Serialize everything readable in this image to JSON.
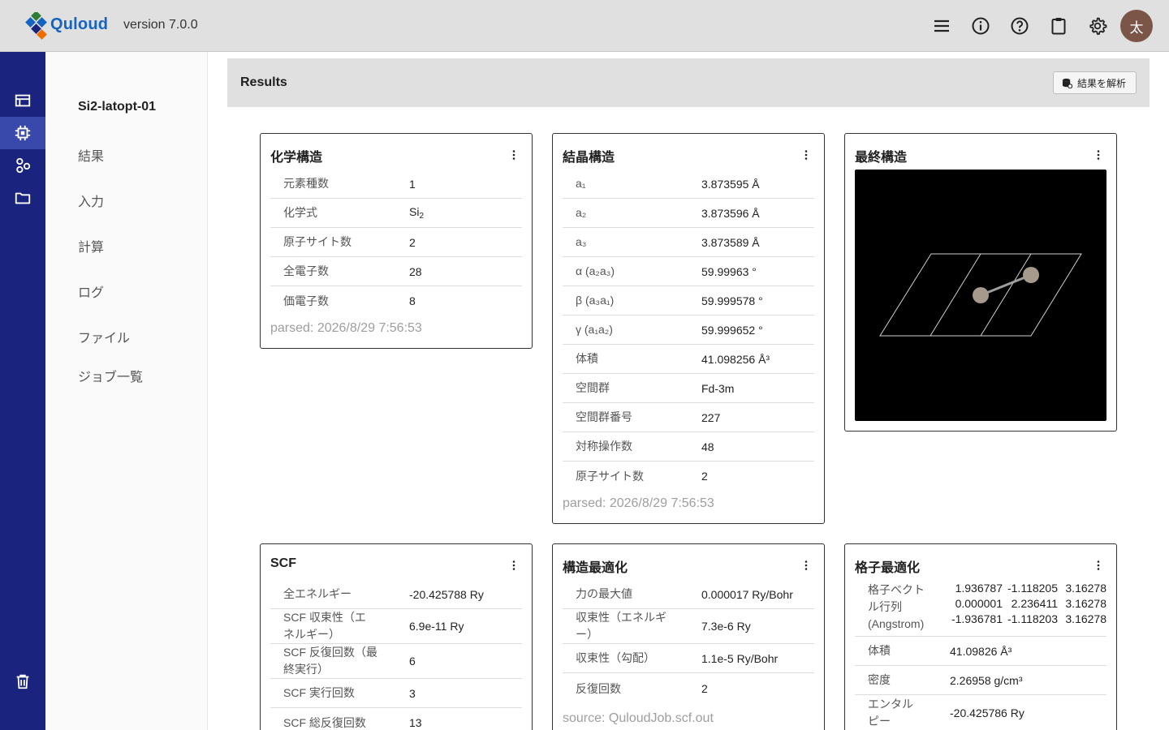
{
  "app": {
    "brand": "Quloud",
    "version": "version 7.0.0",
    "avatar_initial": "太",
    "colors": {
      "header": "#e0e0e0",
      "rail": "#1a237e",
      "rail_active": "#3949ab",
      "avatar": "#7a5548",
      "brand": "#1565c0"
    },
    "header_icons": [
      "menu-icon",
      "info-icon",
      "help-icon",
      "clipboard-icon",
      "gear-icon"
    ]
  },
  "rail": {
    "items": [
      "table-icon",
      "chip-icon",
      "apps-icon",
      "folder-icon"
    ],
    "bottom": "trash-icon",
    "active_index": 1
  },
  "subnav": {
    "job_name": "Si2-latopt-01",
    "items": [
      "結果",
      "入力",
      "計算",
      "ログ",
      "ファイル",
      "ジョブ一覧"
    ]
  },
  "results": {
    "title": "Results",
    "analyze_button": "結果を解析"
  },
  "chem_card": {
    "title": "化学構造",
    "rows": [
      {
        "k": "元素種数",
        "v": "1"
      },
      {
        "k": "化学式",
        "v": "Si",
        "sub": "2"
      },
      {
        "k": "原子サイト数",
        "v": "2"
      },
      {
        "k": "全電子数",
        "v": "28"
      },
      {
        "k": "価電子数",
        "v": "8"
      }
    ],
    "footer": "parsed: 2026/8/29 7:56:53"
  },
  "crystal_card": {
    "title": "結晶構造",
    "rows": [
      {
        "k": "a₁",
        "v": "3.873595 Å"
      },
      {
        "k": "a₂",
        "v": "3.873596 Å"
      },
      {
        "k": "a₃",
        "v": "3.873589 Å"
      },
      {
        "k": "α (a₂a₃)",
        "v": "59.99963 °"
      },
      {
        "k": "β (a₃a₁)",
        "v": "59.999578 °"
      },
      {
        "k": "γ (a₁a₂)",
        "v": "59.999652 °"
      },
      {
        "k": "体積",
        "v": "41.098256 Å³"
      },
      {
        "k": "空間群",
        "v": "Fd-3m"
      },
      {
        "k": "空間群番号",
        "v": "227"
      },
      {
        "k": "対称操作数",
        "v": "48"
      },
      {
        "k": "原子サイト数",
        "v": "2"
      }
    ],
    "footer": "parsed: 2026/8/29 7:56:53"
  },
  "final_card": {
    "title": "最終構造"
  },
  "scf_card": {
    "title": "SCF",
    "rows": [
      {
        "k": "全エネルギー",
        "v": "-20.425788 Ry"
      },
      {
        "k": "SCF 収束性（エネルギー）",
        "v": "6.9e-11 Ry"
      },
      {
        "k": "SCF 反復回数（最終実行）",
        "v": "6"
      },
      {
        "k": "SCF 実行回数",
        "v": "3"
      },
      {
        "k": "SCF 総反復回数",
        "v": "13"
      }
    ]
  },
  "opt_card": {
    "title": "構造最適化",
    "rows": [
      {
        "k": "力の最大値",
        "v": "0.000017 Ry/Bohr"
      },
      {
        "k": "収束性（エネルギー）",
        "v": "7.3e-6 Ry"
      },
      {
        "k": "収束性（勾配）",
        "v": "1.1e-5 Ry/Bohr"
      },
      {
        "k": "反復回数",
        "v": "2"
      }
    ],
    "footer": "source: QuloudJob.scf.out"
  },
  "lattice_card": {
    "title": "格子最適化",
    "matrix_label": "格子ベクトル行列 (Angstrom)",
    "matrix": [
      [
        "1.936787",
        "-1.118205",
        "3.16278"
      ],
      [
        "0.000001",
        "2.236411",
        "3.16278"
      ],
      [
        "-1.936781",
        "-1.118203",
        "3.16278"
      ]
    ],
    "rows": [
      {
        "k": "体積",
        "v": "41.09826 Å³"
      },
      {
        "k": "密度",
        "v": "2.26958 g/cm³"
      },
      {
        "k": "エンタルピー",
        "v": "-20.425786 Ry"
      }
    ]
  }
}
